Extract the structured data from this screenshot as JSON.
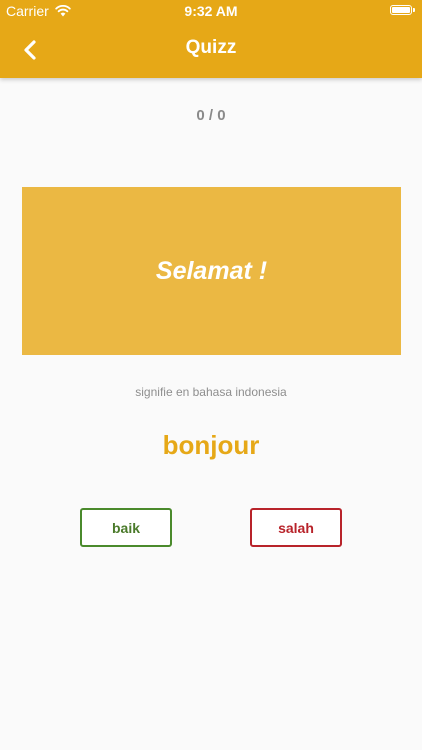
{
  "status_bar": {
    "carrier": "Carrier",
    "time": "9:32 AM",
    "wifi_icon": "wifi-icon",
    "battery_icon": "battery-icon"
  },
  "header": {
    "title": "Quizz",
    "back_icon": "chevron-left-icon",
    "background_color": "#e6a817"
  },
  "quiz": {
    "counter": "0 / 0",
    "card_word": "Selamat !",
    "card_color": "#ebb843",
    "subtitle": "signifie en bahasa indonesia",
    "answer_word": "bonjour",
    "answer_color": "#e6a817"
  },
  "buttons": {
    "correct_label": "baik",
    "correct_color": "#4a8a2c",
    "wrong_label": "salah",
    "wrong_color": "#b8232a"
  }
}
